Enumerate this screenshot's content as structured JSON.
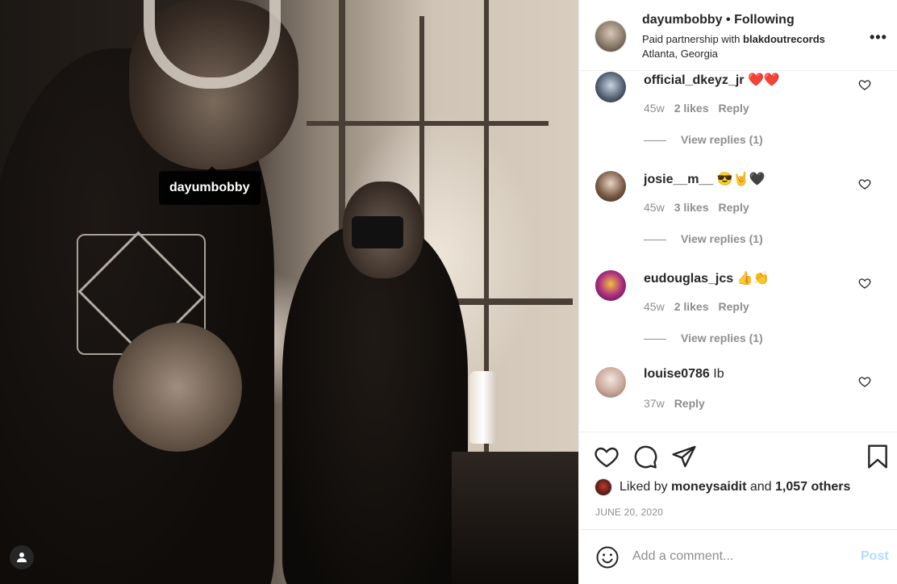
{
  "photo": {
    "tagged_user": "dayumbobby"
  },
  "header": {
    "username": "dayumbobby",
    "separator": "•",
    "follow_status": "Following",
    "partner_prefix": "Paid partnership with",
    "partner_name": "blakdoutrecords",
    "location": "Atlanta, Georgia",
    "more_label": "•••"
  },
  "comments": [
    {
      "username": "official_dkeyz_jr",
      "text": "❤️❤️",
      "age": "45w",
      "likes": "2 likes",
      "reply": "Reply",
      "view_replies": "View replies (1)"
    },
    {
      "username": "josie__m__",
      "text": "😎🤘🖤",
      "age": "45w",
      "likes": "3 likes",
      "reply": "Reply",
      "view_replies": "View replies (1)"
    },
    {
      "username": "eudouglas_jcs",
      "text": "👍👏",
      "age": "45w",
      "likes": "2 likes",
      "reply": "Reply",
      "view_replies": "View replies (1)"
    },
    {
      "username": "louise0786",
      "text": "Ib",
      "age": "37w",
      "reply": "Reply"
    }
  ],
  "actions": {
    "liked_prefix": "Liked by",
    "liked_user": "moneysaidit",
    "liked_and": "and",
    "liked_others": "1,057 others",
    "date": "JUNE 20, 2020"
  },
  "add_comment": {
    "placeholder": "Add a comment...",
    "post_label": "Post"
  },
  "colors": {
    "text": "#262626",
    "muted": "#8e8e8e",
    "post_disabled": "#b3dbff",
    "heart_red": "#ed4956"
  }
}
